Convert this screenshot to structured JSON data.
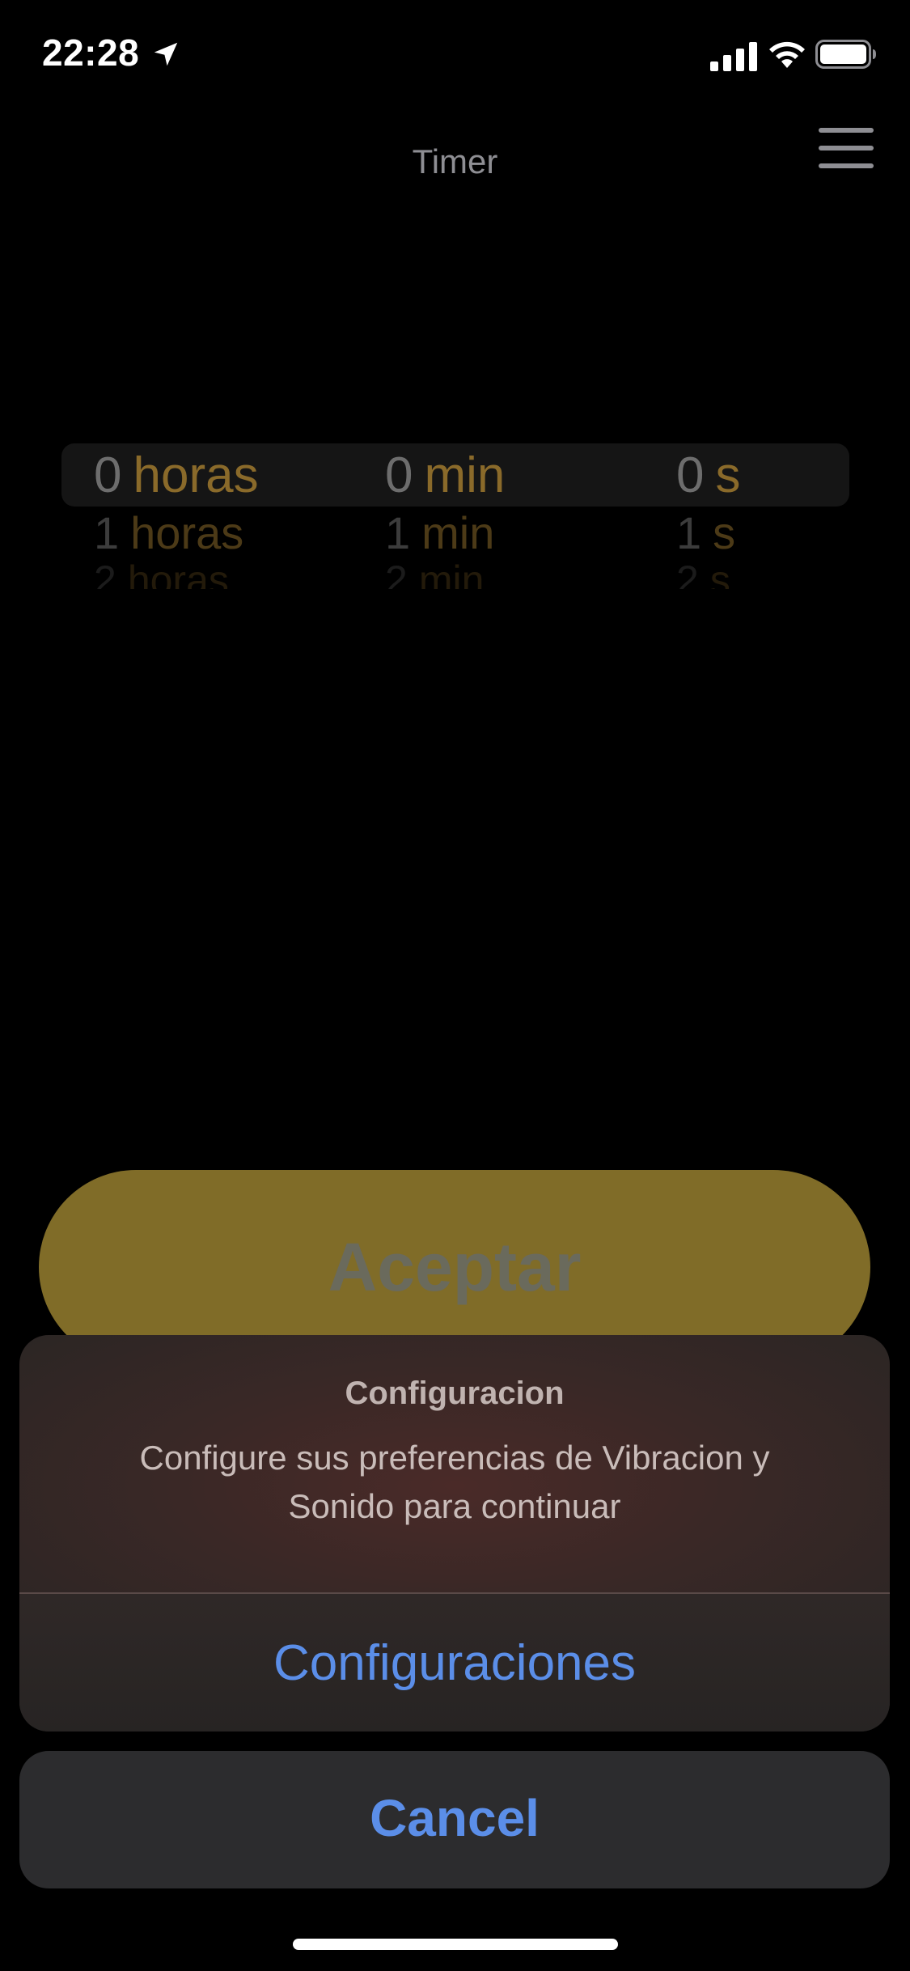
{
  "status_bar": {
    "time": "22:28",
    "icons": [
      "location-icon",
      "signal-icon",
      "wifi-icon",
      "battery-icon"
    ]
  },
  "nav": {
    "title": "Timer",
    "menu_icon": "hamburger-menu-icon"
  },
  "picker": {
    "hours": {
      "rows": [
        {
          "num": "0",
          "unit": "horas"
        },
        {
          "num": "1",
          "unit": "horas"
        },
        {
          "num": "2",
          "unit": "horas"
        }
      ]
    },
    "minutes": {
      "rows": [
        {
          "num": "0",
          "unit": "min"
        },
        {
          "num": "1",
          "unit": "min"
        },
        {
          "num": "2",
          "unit": "min"
        }
      ]
    },
    "seconds": {
      "rows": [
        {
          "num": "0",
          "unit": "s"
        },
        {
          "num": "1",
          "unit": "s"
        },
        {
          "num": "2",
          "unit": "s"
        }
      ]
    }
  },
  "accept_button": {
    "label": "Aceptar"
  },
  "action_sheet": {
    "title": "Configuracion",
    "message": "Configure sus preferencias de Vibracion y Sonido para continuar",
    "action_label": "Configuraciones",
    "cancel_label": "Cancel"
  },
  "colors": {
    "background": "#000000",
    "accent_gold": "#806c28",
    "action_blue": "#5b8ee8",
    "unit_brown": "#8a6a2a"
  }
}
